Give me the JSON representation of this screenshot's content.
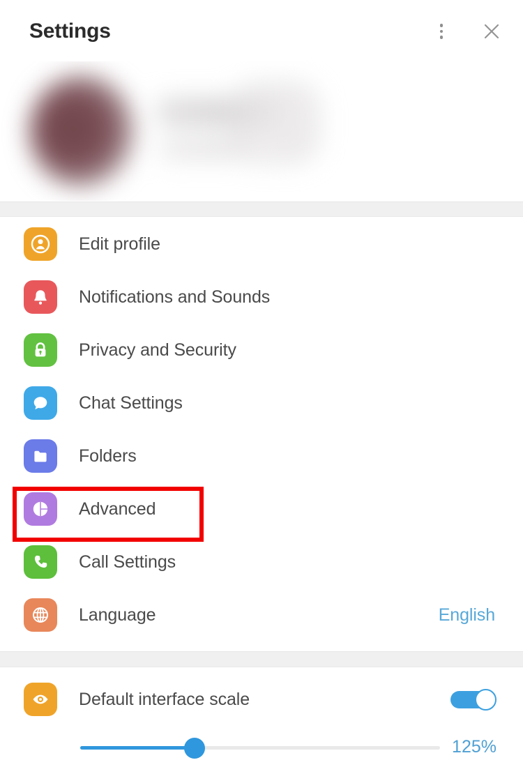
{
  "header": {
    "title": "Settings",
    "menu_icon": "more-vertical-icon",
    "close_icon": "close-icon"
  },
  "profile": {
    "blurred": true,
    "avatar_icon": "avatar-blurred",
    "name_redacted": "",
    "subtitle_redacted": ""
  },
  "settings_list": [
    {
      "label": "Edit profile",
      "icon": "person-icon",
      "color": "#EFA429",
      "value": ""
    },
    {
      "label": "Notifications and Sounds",
      "icon": "bell-icon",
      "color": "#E8585B",
      "value": ""
    },
    {
      "label": "Privacy and Security",
      "icon": "lock-icon",
      "color": "#62C141",
      "value": ""
    },
    {
      "label": "Chat Settings",
      "icon": "chat-bubble-icon",
      "color": "#3FA9E8",
      "value": ""
    },
    {
      "label": "Folders",
      "icon": "folder-icon",
      "color": "#6B7BE8",
      "value": ""
    },
    {
      "label": "Advanced",
      "icon": "pie-chart-icon",
      "color": "#B07BE0",
      "value": ""
    },
    {
      "label": "Call Settings",
      "icon": "phone-icon",
      "color": "#5DBF3C",
      "value": ""
    },
    {
      "label": "Language",
      "icon": "globe-icon",
      "color": "#E8875A",
      "value": "English"
    }
  ],
  "annotation": {
    "target_label": "Advanced",
    "color": "#F20000"
  },
  "scale_section": {
    "label": "Default interface scale",
    "icon": "eye-icon",
    "icon_color": "#EFA429",
    "toggle_on": true,
    "toggle_color": "#3CA0E0",
    "slider_value": "125%",
    "slider_percent": 32,
    "slider_color": "#2F97DD"
  }
}
